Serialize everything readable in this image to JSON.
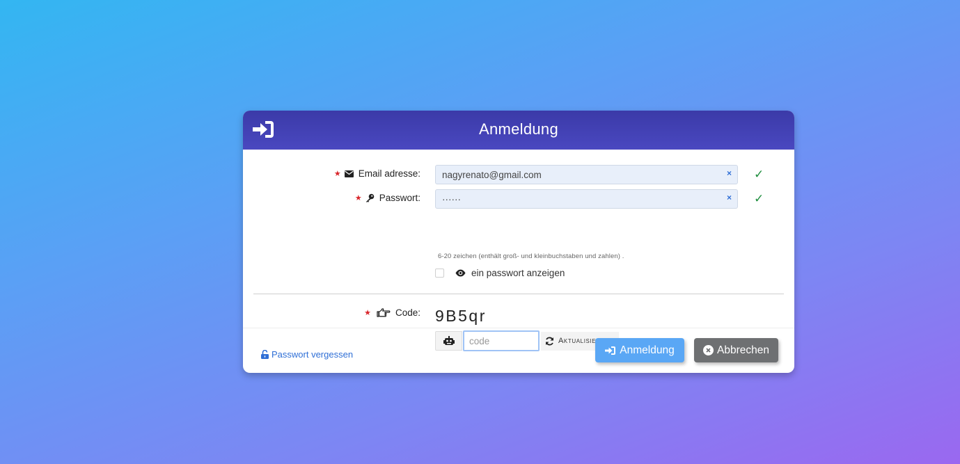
{
  "header": {
    "title": "Anmeldung",
    "icon": "sign-in-icon"
  },
  "form": {
    "email": {
      "label": "Email adresse:",
      "icon": "envelope-icon",
      "value": "nagyrenato@gmail.com",
      "clear": "×",
      "status": "✓"
    },
    "password": {
      "label": "Passwort:",
      "icon": "key-icon",
      "value": "······",
      "clear": "×",
      "status": "✓",
      "hint": "6-20 zeichen (enthält groß- und kleinbuchstaben und zahlen) ."
    },
    "show_password": {
      "label": "ein passwort anzeigen",
      "icon": "eye-icon",
      "checked": false
    },
    "code": {
      "label": "Code:",
      "icon": "hand-pointing-icon",
      "captcha": "9B5qr",
      "placeholder": "code",
      "refresh_label": "Aktualisierung",
      "robot_icon": "robot-icon",
      "refresh_icon": "refresh-icon"
    },
    "required_mark": "★"
  },
  "footer": {
    "forgot_label": "Passwort vergessen",
    "forgot_icon": "unlock-icon",
    "login_label": "Anmeldung",
    "cancel_label": "Abbrechen"
  },
  "colors": {
    "header": "#3b3aa8",
    "login_button": "#5aa7f5",
    "cancel_button": "#6e7072",
    "required": "#d9262b",
    "valid": "#1e8e3e",
    "link": "#2f6fd6"
  }
}
